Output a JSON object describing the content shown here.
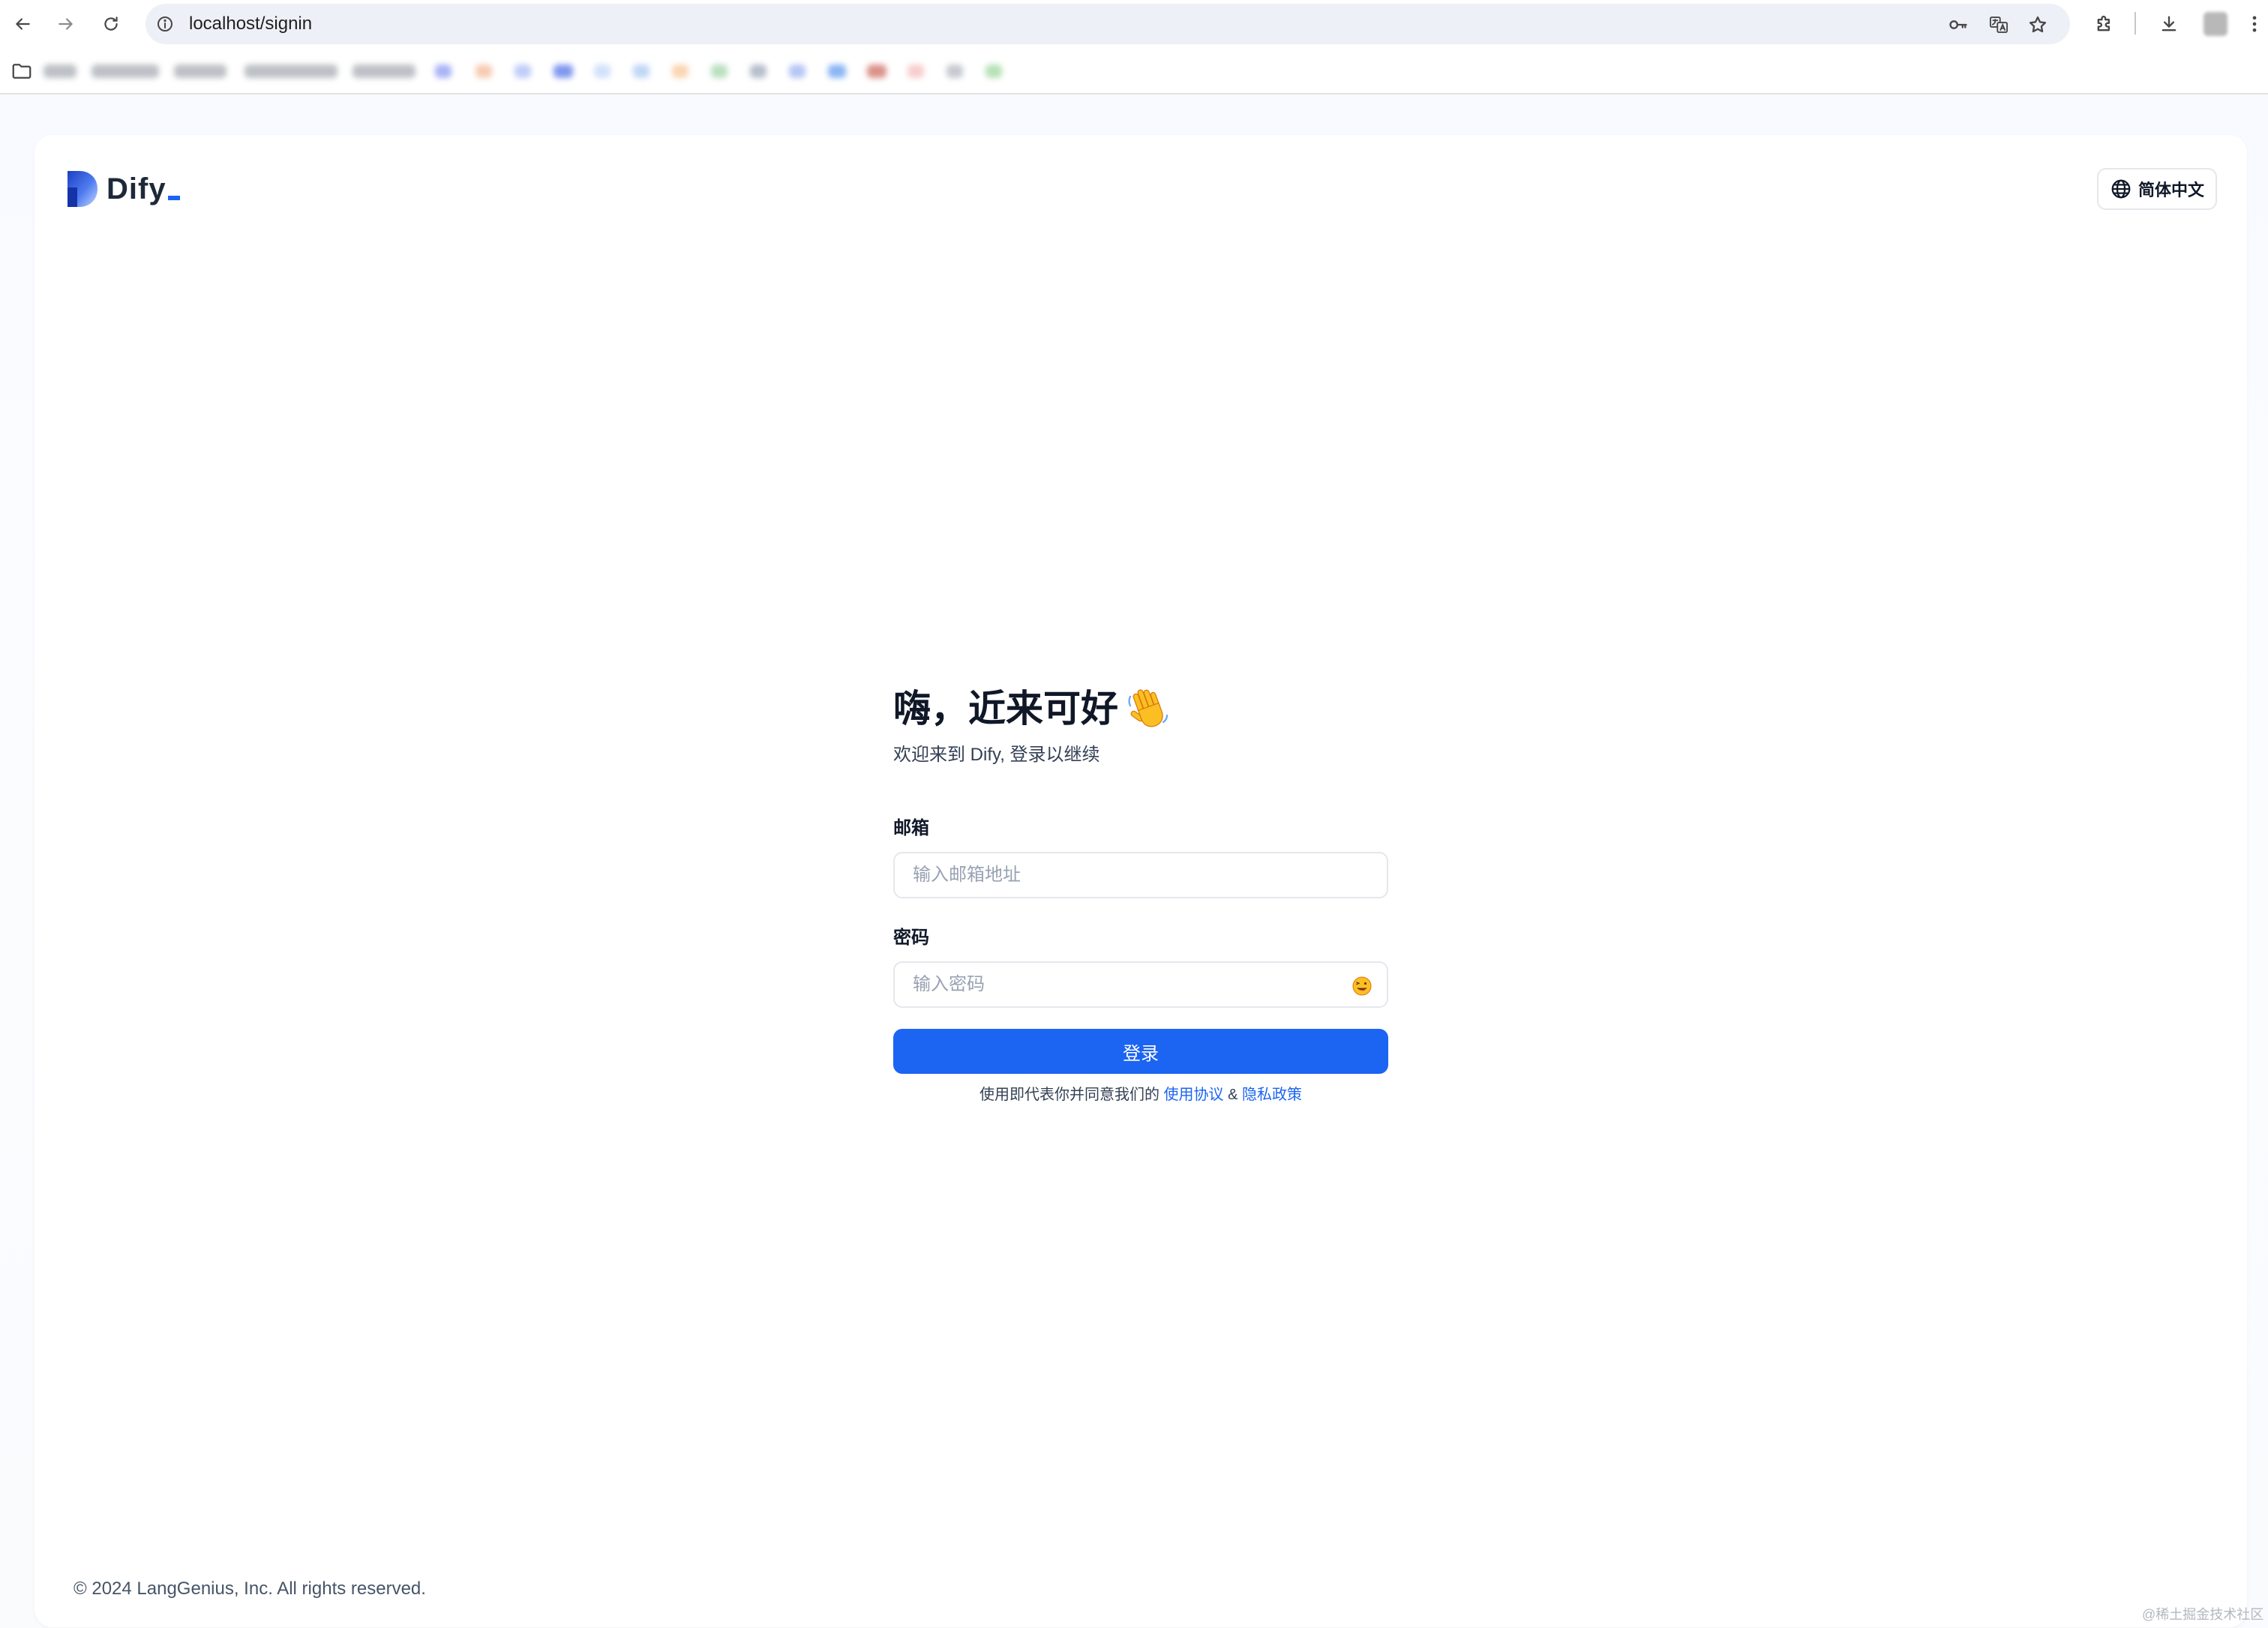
{
  "browser": {
    "url": "localhost/signin",
    "icons": {
      "back": "back-arrow-icon",
      "forward": "forward-arrow-icon",
      "reload": "reload-icon",
      "site_info": "info-icon",
      "password_key": "key-icon",
      "translate": "translate-icon",
      "bookmark_star": "star-icon",
      "extensions": "puzzle-icon",
      "downloads": "download-icon",
      "menu": "kebab-menu-icon",
      "bookmarks_folder": "folder-icon"
    }
  },
  "header": {
    "logo_text": "Dify",
    "language_label": "简体中文"
  },
  "signin": {
    "title": "嗨，近来可好",
    "subtitle": "欢迎来到 Dify, 登录以继续",
    "email_label": "邮箱",
    "email_placeholder": "输入邮箱地址",
    "password_label": "密码",
    "password_placeholder": "输入密码",
    "submit_label": "登录",
    "terms_prefix": "使用即代表你并同意我们的",
    "terms_link": "使用协议",
    "terms_joiner": "&",
    "privacy_link": "隐私政策"
  },
  "footer": {
    "copyright": "© 2024 LangGenius, Inc. All rights reserved."
  },
  "watermark": "@稀土掘金技术社区",
  "colors": {
    "primary": "#1c64f2",
    "text_primary": "#101828",
    "text_secondary": "#344054",
    "border": "#e4e7ec",
    "placeholder": "#98a2b3"
  }
}
